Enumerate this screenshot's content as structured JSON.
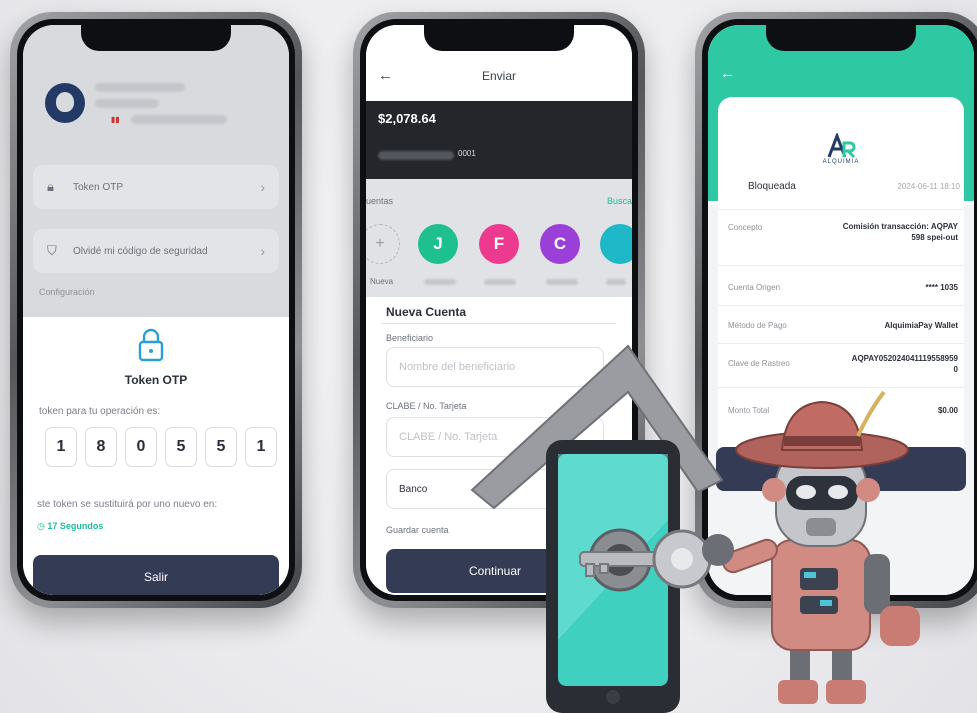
{
  "phone1": {
    "menu_token": "Token OTP",
    "menu_forgot": "Olvidé mi código de seguridad",
    "section_config": "Configuración",
    "otp_title": "Token OTP",
    "otp_desc": "token para tu operación es:",
    "otp_digits": [
      "1",
      "8",
      "0",
      "5",
      "5",
      "1"
    ],
    "otp_note": "ste token se sustituirá por uno nuevo en:",
    "otp_timer": "17 Segundos",
    "exit_button": "Salir"
  },
  "phone2": {
    "title": "Enviar",
    "balance": "$2,078.64",
    "card_suffix": "0001",
    "contacts_label": "uentas",
    "search_link": "Busca",
    "new_label": "Nueva",
    "add_glyph": "+",
    "contacts": [
      "J",
      "F",
      "C"
    ],
    "contact_colors": [
      "#1fc08f",
      "#ec3a8f",
      "#9b3fd9",
      "#1fb8c8"
    ],
    "form_title": "Nueva Cuenta",
    "beneficiary_label": "Beneficiario",
    "beneficiary_placeholder": "Nombre del beneficiario",
    "clabe_label": "CLABE / No. Tarjeta",
    "clabe_placeholder": "CLABE / No. Tarjeta",
    "bank_label": "Banco",
    "save_account_label": "Guardar cuenta",
    "continue_button": "Continuar"
  },
  "phone3": {
    "logo_text": "ALQUIMIA",
    "status": "Bloqueada",
    "date": "2024-06-11 18:10",
    "rows": [
      {
        "label": "Concepto",
        "value": "Comisión transacción: AQPAY 598 spei-out"
      },
      {
        "label": "Cuenta Origen",
        "value": "**** 1035"
      },
      {
        "label": "Método de Pago",
        "value": "AlquimiaPay Wallet"
      },
      {
        "label": "Clave de Rastreo",
        "value": "AQPAY0520240411195589590"
      },
      {
        "label": "Monto Total",
        "value": "$0.00"
      }
    ]
  },
  "colors": {
    "accent": "#2ec9a2",
    "navy_button": "#343b55",
    "dark_card": "#25262b"
  }
}
